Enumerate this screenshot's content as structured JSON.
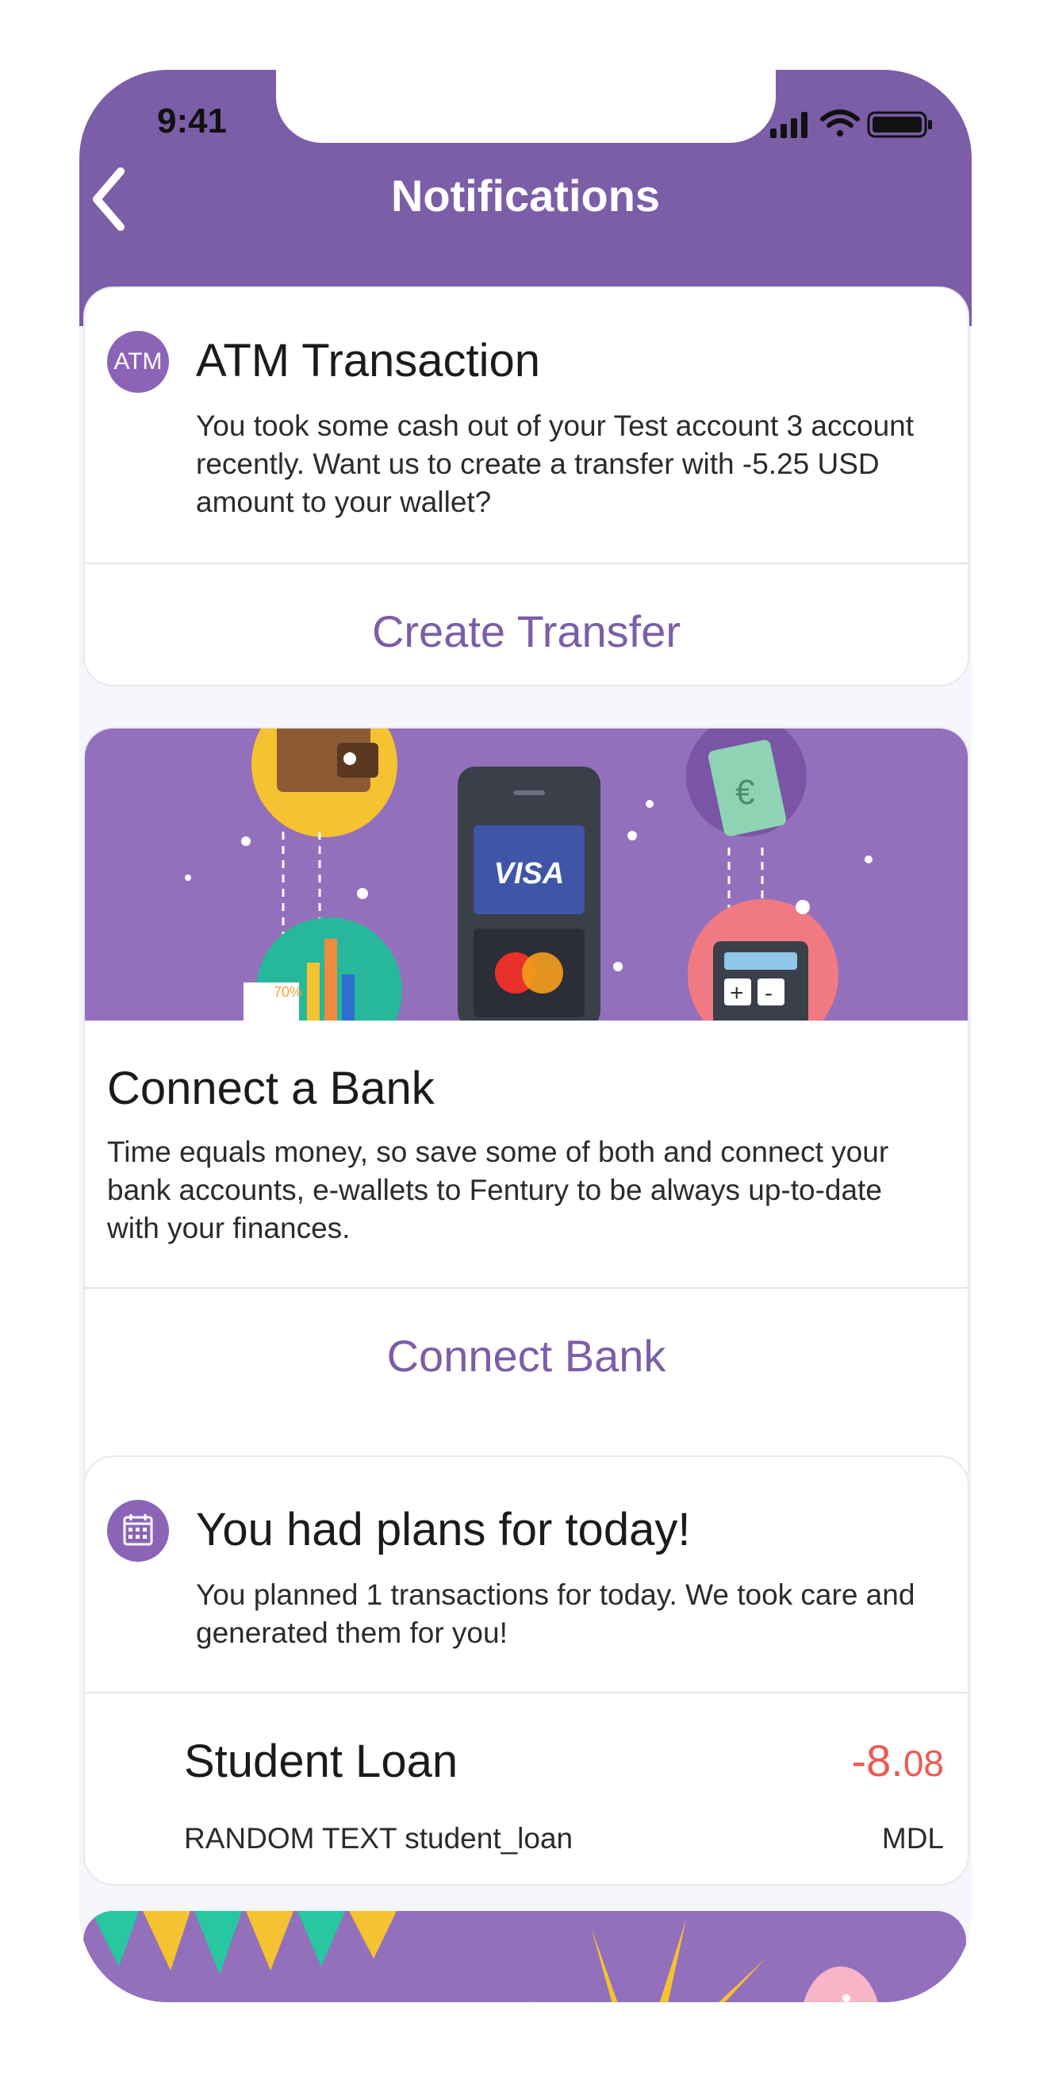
{
  "status_bar": {
    "time": "9:41"
  },
  "header": {
    "title": "Notifications"
  },
  "notifications": [
    {
      "icon_text": "ATM",
      "title": "ATM Transaction",
      "body": "You took some cash out of your Test account 3 account recently. Want us to create a transfer with -5.25 USD amount to your wallet?",
      "action_label": "Create Transfer"
    },
    {
      "banner_card_label": "VISA",
      "title": "Connect a Bank",
      "body": "Time equals money, so save some of both and connect your bank accounts, e-wallets to Fentury to be always up-to-date with your finances.",
      "action_label": "Connect Bank",
      "chart_label": "70%"
    },
    {
      "title": "You had plans for today!",
      "body": "You planned 1 transactions for today. We took care and generated them for you!",
      "transaction": {
        "name": "Student Loan",
        "amount_main": "-8.",
        "amount_cents": "08",
        "description": "RANDOM TEXT student_loan",
        "currency": "MDL"
      }
    }
  ],
  "colors": {
    "accent": "#7b5ea7",
    "negative": "#ec5a54",
    "banner": "#9370bb"
  }
}
